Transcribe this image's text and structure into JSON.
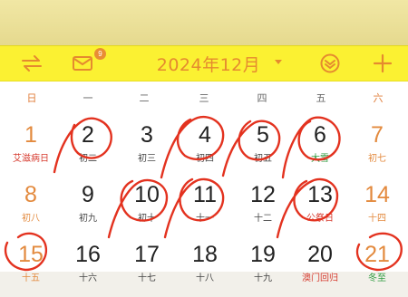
{
  "header": {
    "title": "2024年12月",
    "mail_badge": "9",
    "icons": [
      "swap-icon",
      "mail-icon",
      "today-icon",
      "plus-icon"
    ]
  },
  "weekdays": [
    "日",
    "一",
    "二",
    "三",
    "四",
    "五",
    "六"
  ],
  "weeks": [
    [
      {
        "day": "1",
        "lunar": "艾滋病日",
        "style": "fest"
      },
      {
        "day": "2",
        "lunar": "初二",
        "style": "",
        "circled": true
      },
      {
        "day": "3",
        "lunar": "初三",
        "style": ""
      },
      {
        "day": "4",
        "lunar": "初四",
        "style": "",
        "circled": true
      },
      {
        "day": "5",
        "lunar": "初五",
        "style": "",
        "circled": true
      },
      {
        "day": "6",
        "lunar": "大雪",
        "style": "term",
        "circled": true
      },
      {
        "day": "7",
        "lunar": "初七",
        "style": ""
      }
    ],
    [
      {
        "day": "8",
        "lunar": "初八",
        "style": ""
      },
      {
        "day": "9",
        "lunar": "初九",
        "style": ""
      },
      {
        "day": "10",
        "lunar": "初十",
        "style": "",
        "circled": true
      },
      {
        "day": "11",
        "lunar": "十一",
        "style": "",
        "circled": true
      },
      {
        "day": "12",
        "lunar": "十二",
        "style": ""
      },
      {
        "day": "13",
        "lunar": "公祭日",
        "style": "fest",
        "circled": true
      },
      {
        "day": "14",
        "lunar": "十四",
        "style": ""
      }
    ],
    [
      {
        "day": "15",
        "lunar": "十五",
        "style": "",
        "circled": true
      },
      {
        "day": "16",
        "lunar": "十六",
        "style": ""
      },
      {
        "day": "17",
        "lunar": "十七",
        "style": ""
      },
      {
        "day": "18",
        "lunar": "十八",
        "style": ""
      },
      {
        "day": "19",
        "lunar": "十九",
        "style": ""
      },
      {
        "day": "20",
        "lunar": "澳门回归",
        "style": "fest"
      },
      {
        "day": "21",
        "lunar": "冬至",
        "style": "term",
        "circled": true
      }
    ]
  ],
  "colors": {
    "toolbar": "#fbf132",
    "accent": "#e58a2f",
    "weekend": "#e38a3e",
    "festival": "#d63a2e",
    "solar_term": "#2d9b3e",
    "marker": "#e3321f"
  }
}
